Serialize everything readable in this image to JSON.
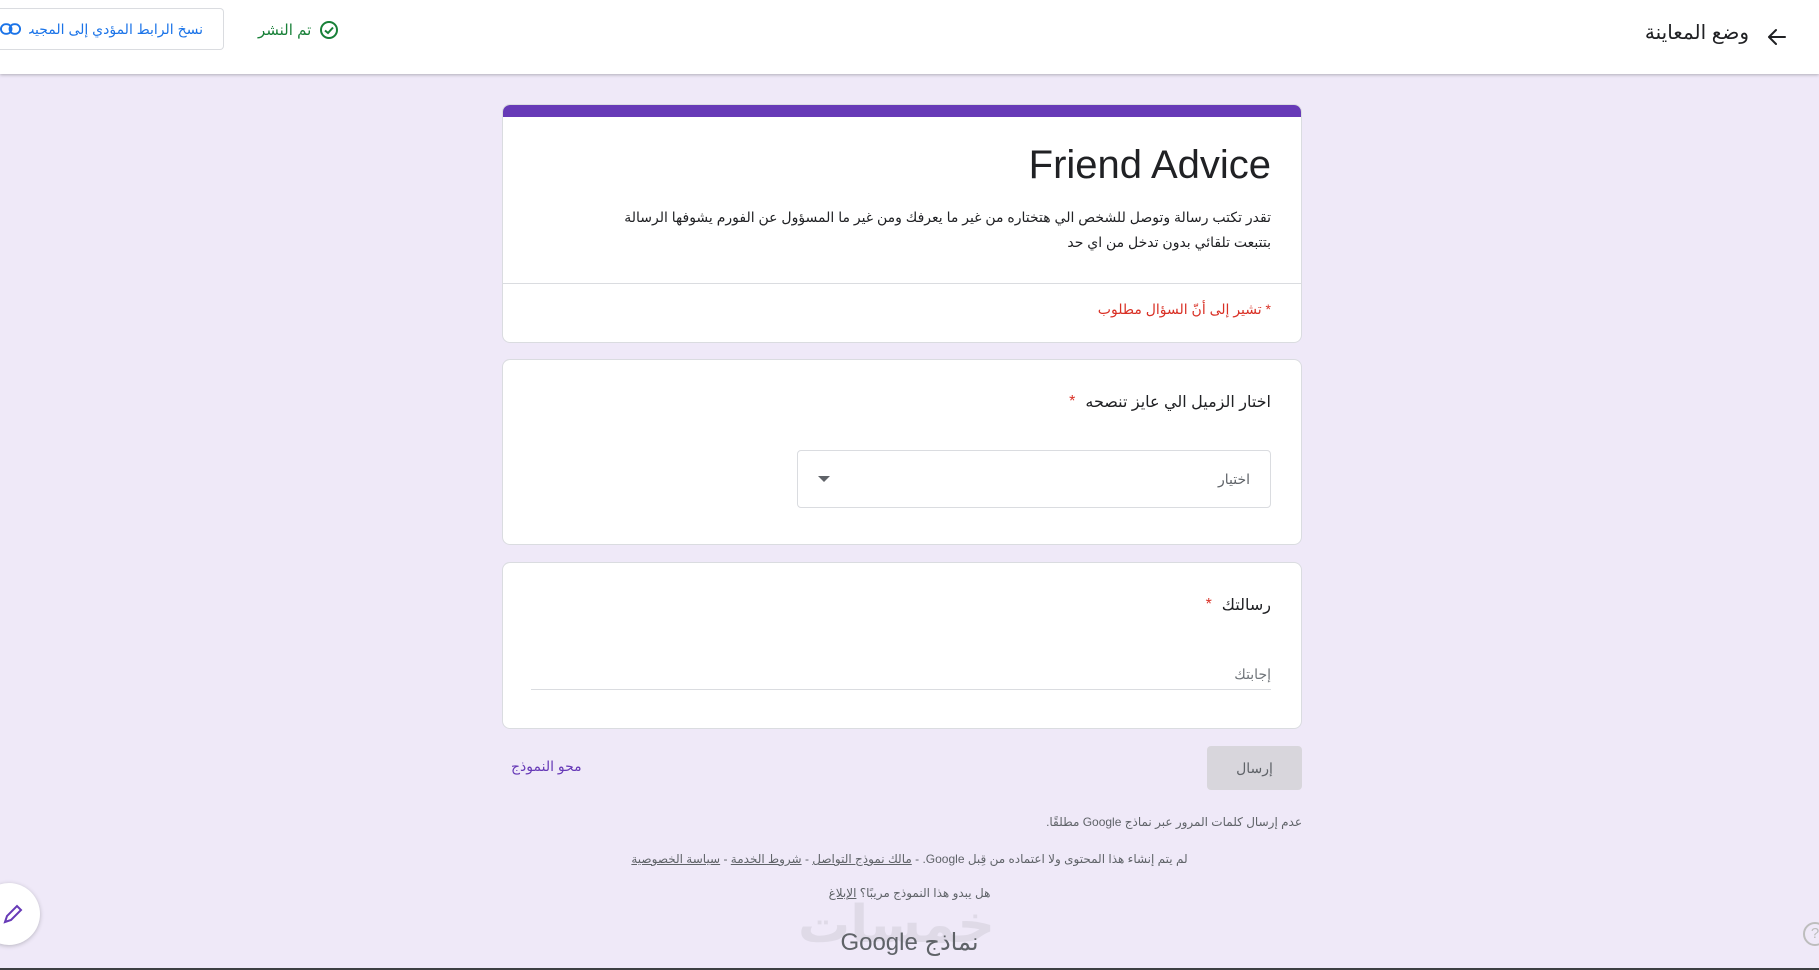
{
  "topbar": {
    "title": "وضع المعاينة",
    "back_icon": "arrow-back-icon",
    "published_label": "تم النشر",
    "copy_link_label": "نسخ الرابط المؤدي إلى المجيب",
    "published_color": "#188038",
    "link_color": "#1a73e8"
  },
  "form": {
    "accent_color": "#673ab7",
    "title": "Friend Advice",
    "description": "تقدر تكتب رسالة وتوصل للشخص الي هتختاره من غير ما يعرفك ومن غير ما المسؤول عن الفورم يشوفها الرسالة بتتبعت تلقائي بدون تدخل من اي حد",
    "required_note": "* تشير إلى أنّ السؤال مطلوب"
  },
  "questions": [
    {
      "title": "اختار الزميل الي عايز تنصحه",
      "required_mark": "*",
      "dropdown_placeholder": "اختيار"
    },
    {
      "title": "رسالتك",
      "required_mark": "*",
      "answer_placeholder": "إجابتك"
    }
  ],
  "actions": {
    "submit_label": "إرسال",
    "clear_label": "محو النموذج"
  },
  "footer": {
    "password_note": "عدم إرسال كلمات المرور عبر نماذج Google مطلقًا.",
    "legal_prefix": "لم يتم إنشاء هذا المحتوى ولا اعتماده من قِبل Google. - ",
    "link_owner": "مالك نموذج التواصل",
    "link_terms": "شروط الخدمة",
    "link_privacy": "سياسة الخصوصية",
    "separator": " - ",
    "spam_question": "هل يبدو هذا النموذج مريبًا؟ ",
    "spam_link": "الإبلاغ",
    "brand_google": "Google",
    "brand_forms": "نماذج",
    "watermark_text": "خمسات"
  }
}
